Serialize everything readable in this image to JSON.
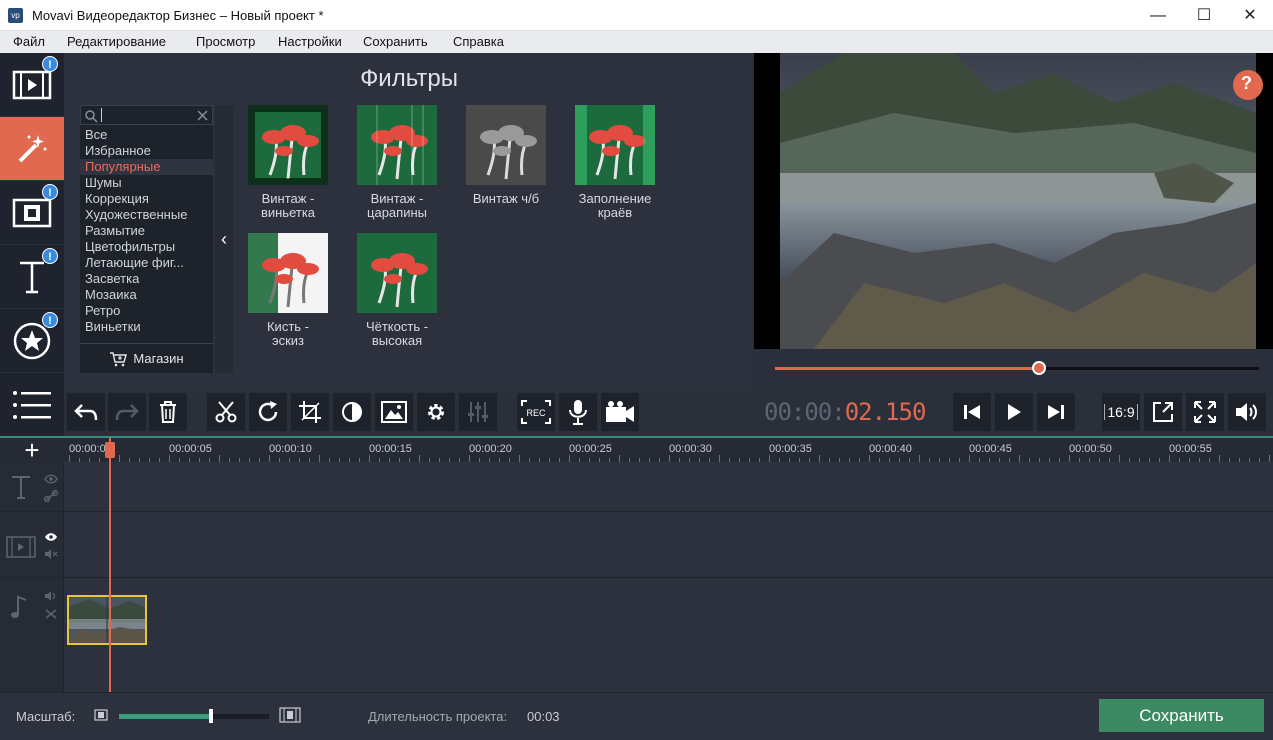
{
  "window": {
    "title": "Movavi Видеоредактор Бизнес – Новый проект *",
    "icon_text": "vp",
    "controls": {
      "minimize": "—",
      "maximize": "☐",
      "close": "✕"
    }
  },
  "menu": [
    "Файл",
    "Редактирование",
    "Просмотр",
    "Настройки",
    "Сохранить",
    "Справка"
  ],
  "sidebar": {
    "items": [
      {
        "name": "import-media",
        "badge": "!"
      },
      {
        "name": "filters",
        "badge": ""
      },
      {
        "name": "transitions",
        "badge": "!"
      },
      {
        "name": "titles",
        "badge": "!"
      },
      {
        "name": "stickers",
        "badge": "!"
      },
      {
        "name": "more",
        "badge": ""
      }
    ]
  },
  "filters": {
    "title": "Фильтры",
    "search_value": "",
    "categories": [
      "Все",
      "Избранное",
      "Популярные",
      "Шумы",
      "Коррекция",
      "Художественные",
      "Размытие",
      "Цветофильтры",
      "Летающие фиг...",
      "Засветка",
      "Мозаика",
      "Ретро",
      "Виньетки"
    ],
    "selected_category": "Популярные",
    "shop_label": "Магазин",
    "collapse_glyph": "‹",
    "items": [
      {
        "label_line1": "Винтаж -",
        "label_line2": "виньетка",
        "style": "vignette"
      },
      {
        "label_line1": "Винтаж -",
        "label_line2": "царапины",
        "style": "scratches"
      },
      {
        "label_line1": "Винтаж ч/б",
        "label_line2": "",
        "style": "bw"
      },
      {
        "label_line1": "Заполнение",
        "label_line2": "краёв",
        "style": "fill"
      },
      {
        "label_line1": "Кисть -",
        "label_line2": "эскиз",
        "style": "sketch"
      },
      {
        "label_line1": "Чёткость -",
        "label_line2": "высокая",
        "style": "sharp"
      }
    ]
  },
  "preview": {
    "help_glyph": "?",
    "progress": 0.545
  },
  "toolbar": {
    "timecode_main": "00:00:",
    "timecode_accent": "02.150",
    "aspect_ratio": "16:9",
    "rec_label": "REC"
  },
  "timeline": {
    "add_glyph": "+",
    "ticks": [
      "00:00:00",
      "00:00:05",
      "00:00:10",
      "00:00:15",
      "00:00:20",
      "00:00:25",
      "00:00:30",
      "00:00:35",
      "00:00:40",
      "00:00:45",
      "00:00:50",
      "00:00:55"
    ]
  },
  "status": {
    "zoom_label": "Масштаб:",
    "zoom_level": 0.61,
    "duration_label": "Длительность проекта:",
    "duration_value": "00:03",
    "save_button": "Сохранить"
  },
  "colors": {
    "accent": "#e0694f",
    "badge": "#3b8bdc",
    "save": "#3c8a64",
    "timeline_line": "#3a8a7c",
    "clip_border": "#e8c43c"
  }
}
